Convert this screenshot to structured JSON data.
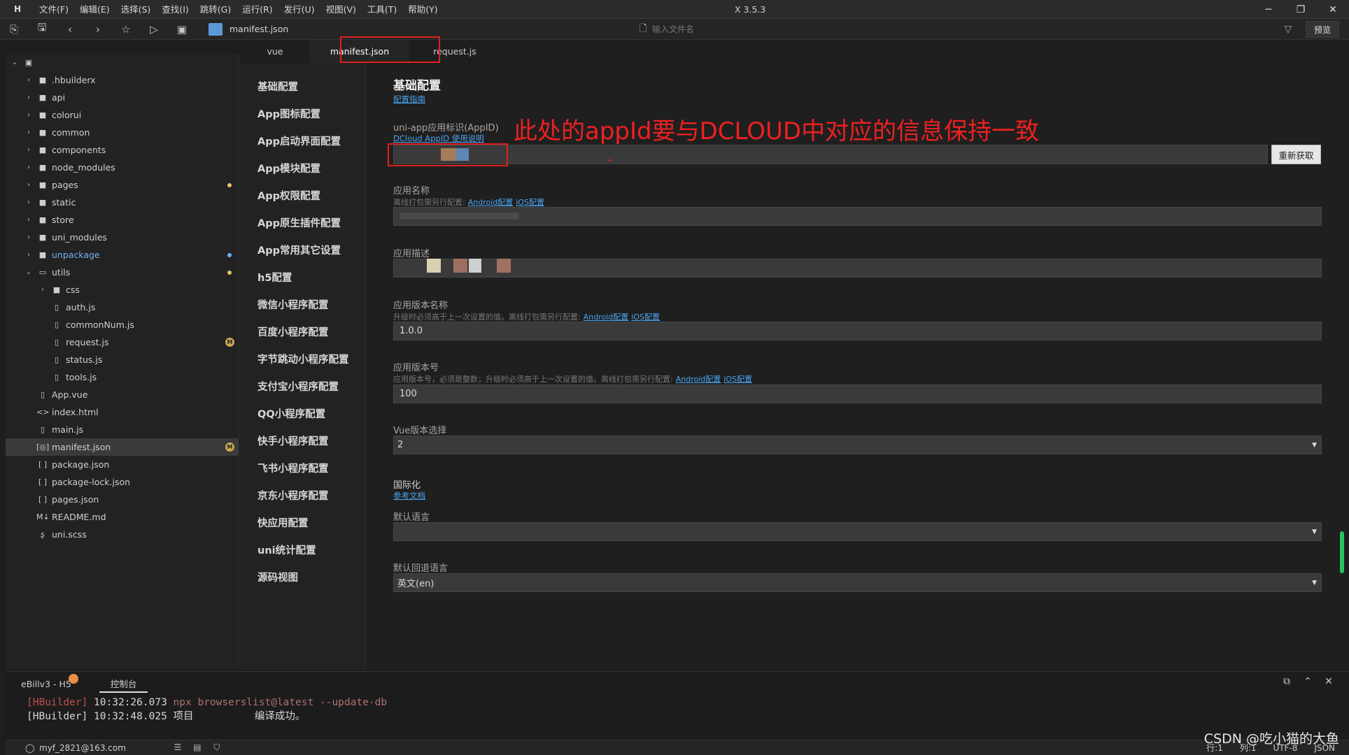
{
  "titlebar": {
    "logo": "H",
    "menu": [
      "文件(F)",
      "编辑(E)",
      "选择(S)",
      "查找(I)",
      "跳转(G)",
      "运行(R)",
      "发行(U)",
      "视图(V)",
      "工具(T)",
      "帮助(Y)"
    ],
    "title": "X 3.5.3",
    "window_buttons": [
      "─",
      "❐",
      "✕"
    ]
  },
  "toolbar": {
    "file_title": "manifest.json",
    "search_placeholder": "输入文件名",
    "preview_label": "预览"
  },
  "tree": [
    {
      "label": "",
      "type": "root",
      "expanded": true
    },
    {
      "label": ".hbuilderx",
      "type": "folder"
    },
    {
      "label": "api",
      "type": "folder"
    },
    {
      "label": "colorui",
      "type": "folder"
    },
    {
      "label": "common",
      "type": "folder"
    },
    {
      "label": "components",
      "type": "folder"
    },
    {
      "label": "node_modules",
      "type": "folder"
    },
    {
      "label": "pages",
      "type": "folder",
      "marker": "yellow-dot"
    },
    {
      "label": "static",
      "type": "folder"
    },
    {
      "label": "store",
      "type": "folder"
    },
    {
      "label": "uni_modules",
      "type": "folder"
    },
    {
      "label": "unpackage",
      "type": "folder",
      "marker": "blue-dot",
      "color": "blue"
    },
    {
      "label": "utils",
      "type": "folder",
      "marker": "yellow-dot",
      "expanded": true
    },
    {
      "label": "css",
      "type": "folder",
      "depth": 1
    },
    {
      "label": "auth.js",
      "type": "file",
      "depth": 1
    },
    {
      "label": "commonNum.js",
      "type": "file",
      "depth": 1
    },
    {
      "label": "request.js",
      "type": "file",
      "depth": 1,
      "marker": "M"
    },
    {
      "label": "status.js",
      "type": "file",
      "depth": 1
    },
    {
      "label": "tools.js",
      "type": "file",
      "depth": 1
    },
    {
      "label": "App.vue",
      "type": "file"
    },
    {
      "label": "index.html",
      "type": "html"
    },
    {
      "label": "main.js",
      "type": "file"
    },
    {
      "label": "manifest.json",
      "type": "json-config",
      "selected": true,
      "marker": "M"
    },
    {
      "label": "package.json",
      "type": "json"
    },
    {
      "label": "package-lock.json",
      "type": "json"
    },
    {
      "label": "pages.json",
      "type": "json"
    },
    {
      "label": "README.md",
      "type": "md"
    },
    {
      "label": "uni.scss",
      "type": "scss"
    }
  ],
  "tabs": [
    {
      "label": "vue",
      "active": false
    },
    {
      "label": "manifest.json",
      "active": true
    },
    {
      "label": "request.js",
      "active": false
    }
  ],
  "settings_nav": [
    "基础配置",
    "App图标配置",
    "App启动界面配置",
    "App模块配置",
    "App权限配置",
    "App原生插件配置",
    "App常用其它设置",
    "h5配置",
    "微信小程序配置",
    "百度小程序配置",
    "字节跳动小程序配置",
    "支付宝小程序配置",
    "QQ小程序配置",
    "快手小程序配置",
    "飞书小程序配置",
    "京东小程序配置",
    "快应用配置",
    "uni统计配置",
    "源码视图"
  ],
  "basic": {
    "title": "基础配置",
    "guide_link": "配置指南",
    "appid": {
      "label": "uni-app应用标识(AppID)",
      "help_link": "DCloud AppID 使用说明",
      "value": "",
      "button": "重新获取"
    },
    "annotation": "此处的appId要与DCLOUD中对应的信息保持一致",
    "app_name": {
      "label": "应用名称",
      "hint": "离线打包需另行配置:",
      "link_android": "Android配置",
      "link_ios": "iOS配置",
      "value": ""
    },
    "app_desc": {
      "label": "应用描述",
      "value": ""
    },
    "version_name": {
      "label": "应用版本名称",
      "hint": "升级时必须高于上一次设置的值。离线打包需另行配置:",
      "link_android": "Android配置",
      "link_ios": "iOS配置",
      "value": "1.0.0"
    },
    "version_code": {
      "label": "应用版本号",
      "hint": "应用版本号，必须是整数；升级时必须高于上一次设置的值。离线打包需另行配置:",
      "link_android": "Android配置",
      "link_ios": "iOS配置",
      "value": "100"
    },
    "vue_version": {
      "label": "Vue版本选择",
      "value": "2"
    },
    "i18n": {
      "label": "国际化",
      "doc_link": "参考文档"
    },
    "default_lang": {
      "label": "默认语言",
      "value": ""
    },
    "fallback_lang": {
      "label": "默认回退语言",
      "value": "英文(en)"
    }
  },
  "bottom": {
    "project_tab": "eBillv3 - H5",
    "console_tab": "控制台",
    "console_lines": [
      {
        "tag": "[HBuilder]",
        "time": "10:32:26.073",
        "text": "npx browserslist@latest --update-db"
      },
      {
        "tag": "[HBuilder]",
        "time": "10:32:48.025",
        "text": "项目          编译成功。"
      }
    ]
  },
  "status": {
    "user": "myf_2821@163.com",
    "line": "行:1",
    "col": "列:1",
    "encoding": "UTF-8",
    "lang": "JSON"
  },
  "watermark": "CSDN @吃小猫的大鱼",
  "colors": {
    "accent": "#4aa3f0",
    "annotation_red": "#ee2020",
    "badge_yellow": "#c9a84f"
  }
}
